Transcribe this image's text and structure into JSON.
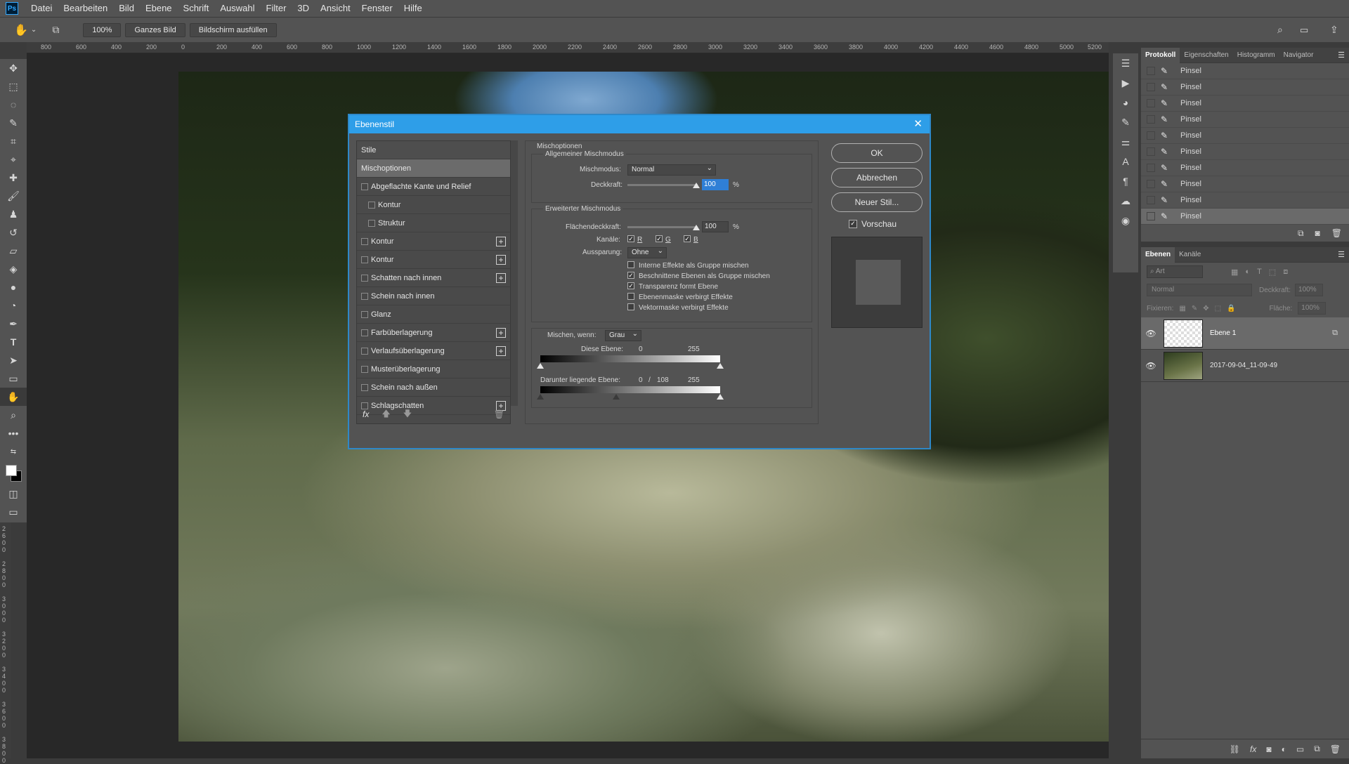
{
  "app": {
    "logo": "Ps"
  },
  "menu": [
    "Datei",
    "Bearbeiten",
    "Bild",
    "Ebene",
    "Schrift",
    "Auswahl",
    "Filter",
    "3D",
    "Ansicht",
    "Fenster",
    "Hilfe"
  ],
  "options": {
    "zoom": "100%",
    "fit": "Ganzes Bild",
    "fill": "Bildschirm ausfüllen"
  },
  "ruler": {
    "top": [
      "800",
      "600",
      "400",
      "200",
      "0",
      "200",
      "400",
      "600",
      "800",
      "1000",
      "1200",
      "1400",
      "1600",
      "1800",
      "2000",
      "2200",
      "2400",
      "2600",
      "2800",
      "3000",
      "3200",
      "3400",
      "3600",
      "3800",
      "4000",
      "4200",
      "4400",
      "4600",
      "4800",
      "5000",
      "5200"
    ],
    "left": [
      "2600",
      "2800",
      "3000",
      "3200",
      "3400",
      "3600",
      "3800"
    ]
  },
  "history": {
    "tabs": [
      "Protokoll",
      "Eigenschaften",
      "Histogramm",
      "Navigator"
    ],
    "items": [
      "Pinsel",
      "Pinsel",
      "Pinsel",
      "Pinsel",
      "Pinsel",
      "Pinsel",
      "Pinsel",
      "Pinsel",
      "Pinsel",
      "Pinsel"
    ]
  },
  "layers": {
    "tabs": [
      "Ebenen",
      "Kanäle"
    ],
    "filter": "Art",
    "blend": "Normal",
    "opacity_label": "Deckkraft:",
    "opacity": "100%",
    "lock_label": "Fixieren:",
    "fill_label": "Fläche:",
    "fill": "100%",
    "items": [
      {
        "name": "Ebene 1"
      },
      {
        "name": "2017-09-04_11-09-49"
      }
    ]
  },
  "dialog": {
    "title": "Ebenenstil",
    "styles_header": "Stile",
    "styles": [
      {
        "label": "Mischoptionen",
        "checkbox": false,
        "plus": false,
        "indent": false
      },
      {
        "label": "Abgeflachte Kante und Relief",
        "checkbox": true,
        "plus": false,
        "indent": false
      },
      {
        "label": "Kontur",
        "checkbox": true,
        "plus": false,
        "indent": true
      },
      {
        "label": "Struktur",
        "checkbox": true,
        "plus": false,
        "indent": true
      },
      {
        "label": "Kontur",
        "checkbox": true,
        "plus": true,
        "indent": false
      },
      {
        "label": "Kontur",
        "checkbox": true,
        "plus": true,
        "indent": false
      },
      {
        "label": "Schatten nach innen",
        "checkbox": true,
        "plus": true,
        "indent": false
      },
      {
        "label": "Schein nach innen",
        "checkbox": true,
        "plus": false,
        "indent": false
      },
      {
        "label": "Glanz",
        "checkbox": true,
        "plus": false,
        "indent": false
      },
      {
        "label": "Farbüberlagerung",
        "checkbox": true,
        "plus": true,
        "indent": false
      },
      {
        "label": "Verlaufsüberlagerung",
        "checkbox": true,
        "plus": true,
        "indent": false
      },
      {
        "label": "Musterüberlagerung",
        "checkbox": true,
        "plus": false,
        "indent": false
      },
      {
        "label": "Schein nach außen",
        "checkbox": true,
        "plus": false,
        "indent": false
      },
      {
        "label": "Schlagschatten",
        "checkbox": true,
        "plus": true,
        "indent": false
      }
    ],
    "fx": "fx",
    "section_title": "Mischoptionen",
    "general": "Allgemeiner Mischmodus",
    "blend_label": "Mischmodus:",
    "blend_value": "Normal",
    "opacity_label": "Deckkraft:",
    "opacity_value": "100",
    "percent": "%",
    "advanced": "Erweiterter Mischmodus",
    "fill_label": "Flächendeckkraft:",
    "fill_value": "100",
    "channels_label": "Kanäle:",
    "channels": [
      "R",
      "G",
      "B"
    ],
    "knockout_label": "Aussparung:",
    "knockout_value": "Ohne",
    "checks": [
      {
        "label": "Interne Effekte als Gruppe mischen",
        "checked": false
      },
      {
        "label": "Beschnittene Ebenen als Gruppe mischen",
        "checked": true
      },
      {
        "label": "Transparenz formt Ebene",
        "checked": true
      },
      {
        "label": "Ebenenmaske verbirgt Effekte",
        "checked": false
      },
      {
        "label": "Vektormaske verbirgt Effekte",
        "checked": false
      }
    ],
    "blendif_label": "Mischen, wenn:",
    "blendif_value": "Grau",
    "this_layer": "Diese Ebene:",
    "this_low": "0",
    "this_high": "255",
    "under_layer": "Darunter liegende Ebene:",
    "under_low": "0",
    "under_sep": "/",
    "under_mid": "108",
    "under_high": "255",
    "btn_ok": "OK",
    "btn_cancel": "Abbrechen",
    "btn_new": "Neuer Stil...",
    "preview": "Vorschau"
  }
}
